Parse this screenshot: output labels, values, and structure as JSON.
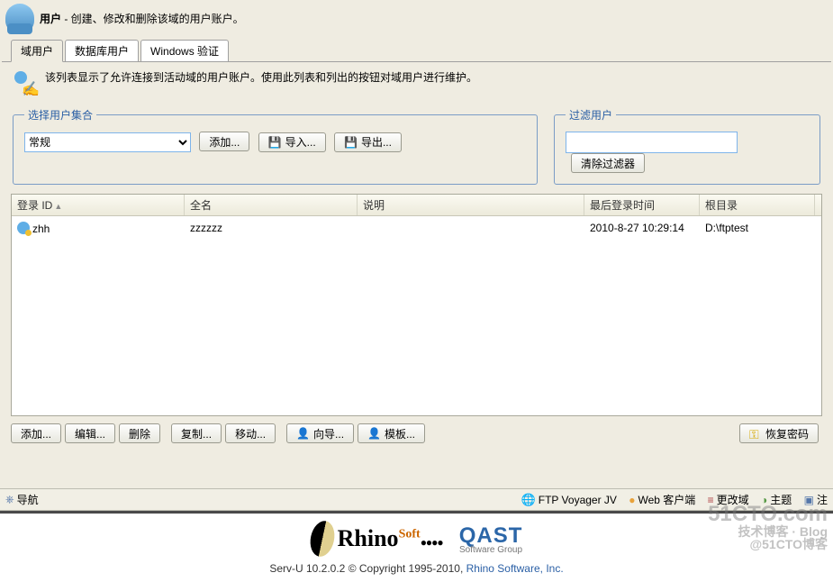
{
  "header": {
    "title": "用户",
    "subtitle": " - 创建、修改和删除该域的用户账户。"
  },
  "tabs": {
    "t0": "域用户",
    "t1": "数据库用户",
    "t2": "Windows 验证"
  },
  "desc": "该列表显示了允许连接到活动域的用户账户。使用此列表和列出的按钮对域用户进行维护。",
  "select_group": {
    "legend": "选择用户集合",
    "value": "常规",
    "add": "添加...",
    "import": "导入...",
    "export": "导出..."
  },
  "filter_group": {
    "legend": "过滤用户",
    "clear": "清除过滤器"
  },
  "grid": {
    "cols": {
      "c0": "登录 ID",
      "c1": "全名",
      "c2": "说明",
      "c3": "最后登录时间",
      "c4": "根目录"
    },
    "rows": [
      {
        "id": "zhh",
        "fullname": "zzzzzz",
        "desc": "",
        "last": "2010-8-27 10:29:14",
        "root": "D:\\ftptest"
      }
    ]
  },
  "actions": {
    "add": "添加...",
    "edit": "编辑...",
    "delete": "删除",
    "copy": "复制...",
    "move": "移动...",
    "wizard": "向导...",
    "template": "模板...",
    "recover": "恢复密码"
  },
  "bottombar": {
    "nav": "导航",
    "voyager": "FTP Voyager JV",
    "web": "Web 客户端",
    "change": "更改域",
    "theme": "主题",
    "logout": "注"
  },
  "brand": {
    "rhino": "Rhino",
    "soft": "Soft",
    "qast": "QAST",
    "qast_sub": "Software Group"
  },
  "copyright": {
    "prefix": "Serv-U 10.2.0.2 © Copyright 1995-2010, ",
    "link": "Rhino Software, Inc."
  },
  "watermark": {
    "l1": "51CTO.com",
    "l2": "技术博客 · Blog",
    "l3": "@51CTO博客"
  }
}
